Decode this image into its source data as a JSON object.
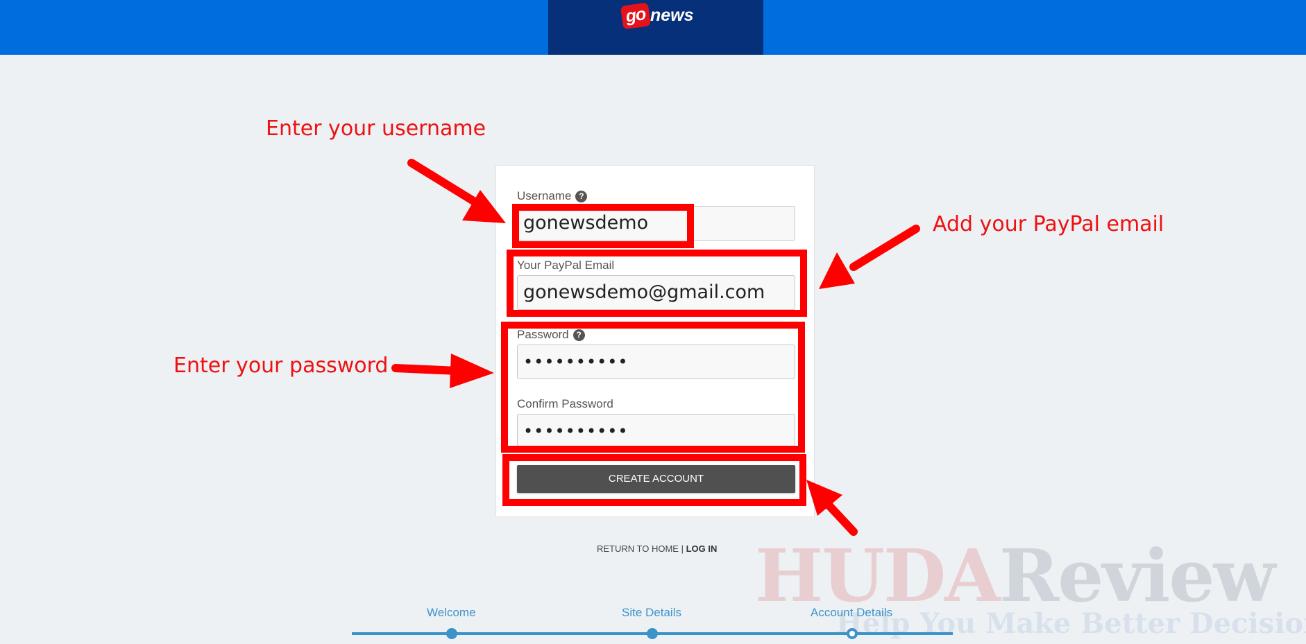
{
  "header": {
    "logo_go": "go",
    "logo_news": "news"
  },
  "form": {
    "username_label": "Username",
    "username_help": "?",
    "username_value": "gonewsdemo",
    "email_label": "Your PayPal Email",
    "email_value": "gonewsdemo@gmail.com",
    "password_label": "Password",
    "password_help": "?",
    "password_value": "••••••••••",
    "confirm_label": "Confirm Password",
    "confirm_value": "••••••••••",
    "submit_label": "CREATE ACCOUNT"
  },
  "links": {
    "home": "RETURN TO HOME",
    "separator": " | ",
    "login": "LOG IN"
  },
  "steps": [
    {
      "label": "Welcome"
    },
    {
      "label": "Site Details"
    },
    {
      "label": "Account Details",
      "current": true
    }
  ],
  "annotations": {
    "username": "Enter your username",
    "email": "Add your PayPal email",
    "password": "Enter your password",
    "color": "#ff0000"
  },
  "watermark": {
    "part1": "HUDA",
    "part2": "Review",
    "tagline": "Help You Make Better Decisions"
  },
  "colors": {
    "header": "#006ddf",
    "logo_bg": "#06307a",
    "accent": "#3b93c9",
    "button": "#505050"
  }
}
